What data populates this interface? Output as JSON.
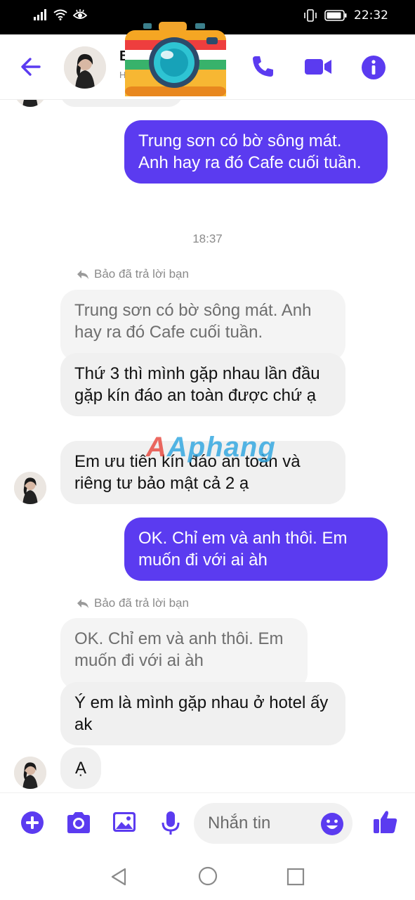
{
  "status_bar": {
    "time": "22:32",
    "icons": [
      "signal-icon",
      "wifi-icon",
      "eye-comfort-icon",
      "vibrate-icon",
      "battery-icon"
    ]
  },
  "header": {
    "contact_name": "B",
    "contact_status": "H",
    "icons": [
      "back-arrow-icon",
      "phone-icon",
      "video-camera-icon",
      "info-icon"
    ],
    "accent_color": "#5b3bf0"
  },
  "messages": [
    {
      "type": "outgoing",
      "text": "Trung sơn có bờ sông mát. Anh hay ra đó Cafe cuối tuần."
    },
    {
      "type": "timestamp",
      "text": "18:37"
    },
    {
      "type": "reply_note",
      "text": "Bảo đã trả lời bạn"
    },
    {
      "type": "quoted",
      "text": "Trung sơn có bờ sông mát. Anh hay ra đó Cafe cuối tuần."
    },
    {
      "type": "incoming",
      "text": "Thứ 3 thì mình gặp nhau lần đầu gặp kín đáo an toàn được chứ ạ"
    },
    {
      "type": "incoming",
      "text": "Em ưu tiên kín đáo an toàn và riêng tư bảo mật cả 2 ạ"
    },
    {
      "type": "outgoing",
      "text": "OK. Chỉ em và anh thôi. Em muốn đi với ai àh"
    },
    {
      "type": "reply_note",
      "text": "Bảo đã trả lời bạn"
    },
    {
      "type": "quoted",
      "text": "OK. Chỉ em và anh thôi. Em muốn đi với ai àh"
    },
    {
      "type": "incoming",
      "text": "Ý em là mình gặp nhau ở hotel ấy ak"
    },
    {
      "type": "incoming",
      "text": "Ạ"
    }
  ],
  "watermark": {
    "text": "Aphang"
  },
  "input_bar": {
    "placeholder": "Nhắn tin",
    "icons": [
      "plus-icon",
      "camera-icon",
      "image-icon",
      "microphone-icon",
      "emoji-icon",
      "thumbs-up-icon"
    ]
  },
  "nav_bar": {
    "icons": [
      "nav-back-icon",
      "nav-home-icon",
      "nav-recent-icon"
    ]
  }
}
